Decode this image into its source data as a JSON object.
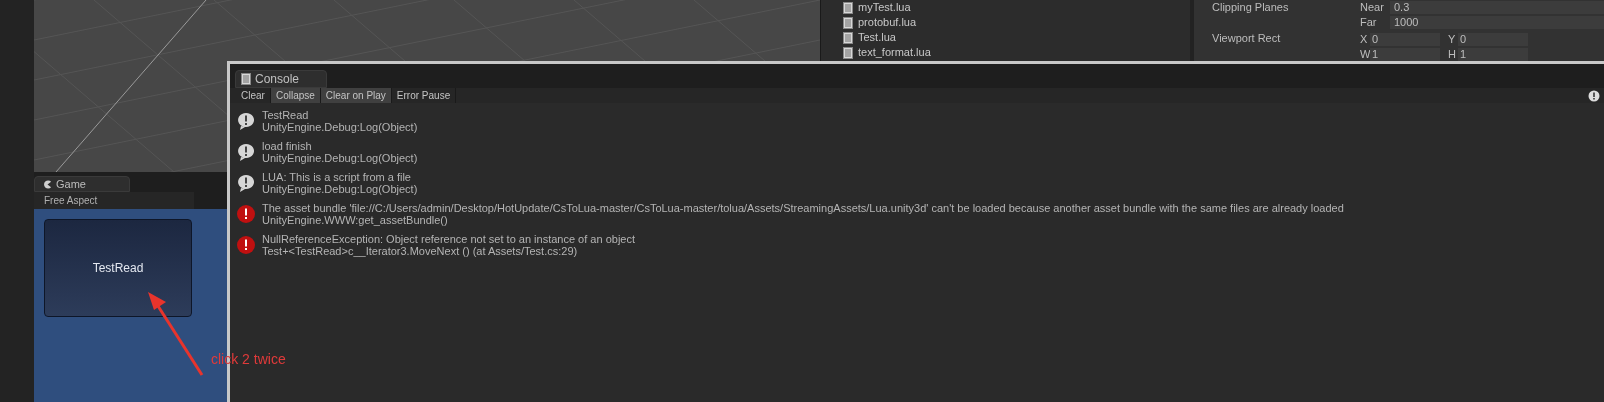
{
  "project": {
    "files": [
      "myTest.lua",
      "protobuf.lua",
      "Test.lua",
      "text_format.lua"
    ]
  },
  "inspector": {
    "clipping_planes": {
      "label": "Clipping Planes",
      "near_label": "Near",
      "near": "0.3",
      "far_label": "Far",
      "far": "1000"
    },
    "viewport_rect": {
      "label": "Viewport Rect",
      "fields": [
        {
          "label": "X",
          "value": "0"
        },
        {
          "label": "Y",
          "value": "0"
        },
        {
          "label": "W",
          "value": "1"
        },
        {
          "label": "H",
          "value": "1"
        }
      ]
    }
  },
  "game": {
    "tab": "Game",
    "aspect": "Free Aspect",
    "button": "TestRead",
    "annotation": "click 2 twice"
  },
  "console": {
    "tab": "Console",
    "toolbar": [
      {
        "label": "Clear",
        "on": false
      },
      {
        "label": "Collapse",
        "on": true
      },
      {
        "label": "Clear on Play",
        "on": true
      },
      {
        "label": "Error Pause",
        "on": false
      }
    ],
    "messages": [
      {
        "kind": "log",
        "text": "TestRead",
        "trace": "UnityEngine.Debug:Log(Object)"
      },
      {
        "kind": "log",
        "text": "load finish",
        "trace": "UnityEngine.Debug:Log(Object)"
      },
      {
        "kind": "log",
        "text": "LUA: This is a script from a file",
        "trace": "UnityEngine.Debug:Log(Object)"
      },
      {
        "kind": "error",
        "text": "The asset bundle 'file://C:/Users/admin/Desktop/HotUpdate/CsToLua-master/CsToLua-master/tolua/Assets/StreamingAssets/Lua.unity3d' can't be loaded because another asset bundle with the same files are already loaded",
        "trace": "UnityEngine.WWW:get_assetBundle()"
      },
      {
        "kind": "error",
        "text": "NullReferenceException: Object reference not set to an instance of an object",
        "trace": "Test+<TestRead>c__Iterator3.MoveNext () (at Assets/Test.cs:29)"
      }
    ]
  }
}
